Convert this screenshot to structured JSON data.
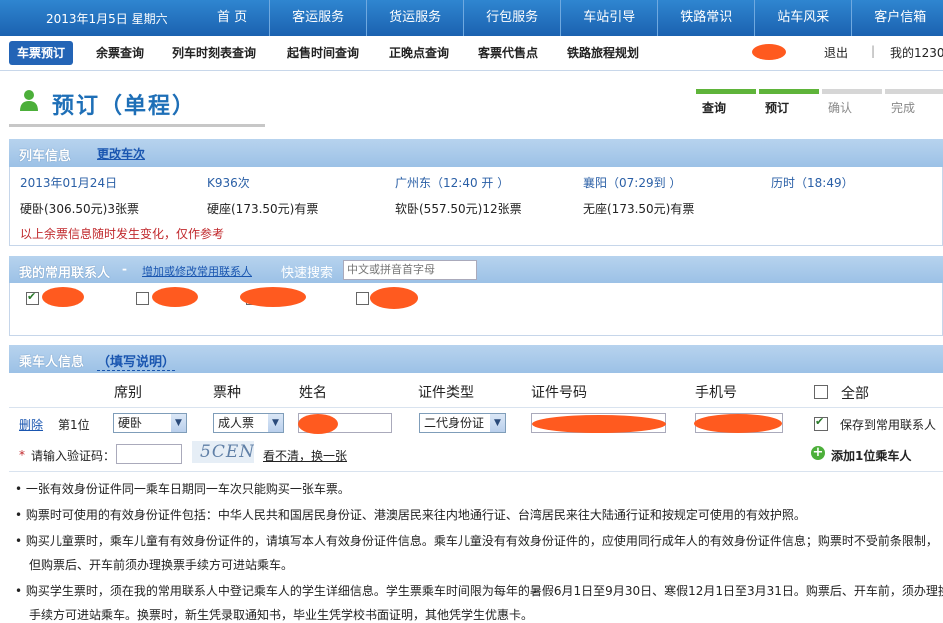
{
  "topbar": {
    "date": "2013年1月5日 星期六",
    "nav": [
      "首 页",
      "客运服务",
      "货运服务",
      "行包服务",
      "车站引导",
      "铁路常识",
      "站车风采",
      "客户信箱"
    ]
  },
  "subnav": {
    "tabs": [
      "车票预订",
      "余票查询",
      "列车时刻表查询",
      "起售时间查询",
      "正晚点查询",
      "客票代售点",
      "铁路旅程规划"
    ],
    "logout": "退出",
    "separator": "|",
    "account": "我的12306"
  },
  "page": {
    "title": "预订（单程）",
    "steps": [
      "查询",
      "预订",
      "确认",
      "完成"
    ]
  },
  "train_info": {
    "header": "列车信息",
    "change_link": "更改车次",
    "date": "2013年01月24日",
    "train_no": "K936次",
    "from": "广州东（12:40 开 ）",
    "to": "襄阳（07:29到 ）",
    "duration": "历时（18:49）",
    "seats": [
      "硬卧(306.50元)3张票",
      "硬座(173.50元)有票",
      "软卧(557.50元)12张票",
      "无座(173.50元)有票"
    ],
    "warning": "以上余票信息随时发生变化，仅作参考"
  },
  "contacts": {
    "header": "我的常用联系人",
    "manage_link": "增加或修改常用联系人",
    "search_label": "快速搜索",
    "search_placeholder": "中文或拼音首字母"
  },
  "passengers": {
    "header": "乘车人信息",
    "help_link": "（填写说明）",
    "columns": {
      "seat": "席别",
      "ticket": "票种",
      "name": "姓名",
      "id_type": "证件类型",
      "id_no": "证件号码",
      "phone": "手机号",
      "all": "全部"
    },
    "row": {
      "delete": "删除",
      "position": "第1位",
      "seat_value": "硬卧",
      "ticket_value": "成人票",
      "id_type_value": "二代身份证",
      "save_label": "保存到常用联系人"
    },
    "captcha_label": "请输入验证码：",
    "captcha_required": "*",
    "captcha_text": "5CEN",
    "refresh_link": "看不清，换一张",
    "add_passenger": "添加1位乘车人"
  },
  "notes": [
    "一张有效身份证件同一乘车日期同一车次只能购买一张车票。",
    "购票时可使用的有效身份证件包括：中华人民共和国居民身份证、港澳居民来往内地通行证、台湾居民来往大陆通行证和按规定可使用的有效护照。",
    "购买儿童票时，乘车儿童有有效身份证件的，请填写本人有效身份证件信息。乘车儿童没有有效身份证件的，应使用同行成年人的有效身份证件信息；购票时不受前条限制，",
    "但购票后、开车前须办理换票手续方可进站乘车。",
    "购买学生票时，须在我的常用联系人中登记乘车人的学生详细信息。学生票乘车时间限为每年的暑假6月1日至9月30日、寒假12月1日至3月31日。购票后、开车前，须办理换票",
    "手续方可进站乘车。换票时，新生凭录取通知书，毕业生凭学校书面证明，其他凭学生优惠卡。"
  ],
  "colors": {
    "topbar": "#1b62b0",
    "accent_blue": "#1e6fb7",
    "step_green": "#5fb43a",
    "warning_red": "#c0282c",
    "redaction": "#ff5a1f"
  }
}
